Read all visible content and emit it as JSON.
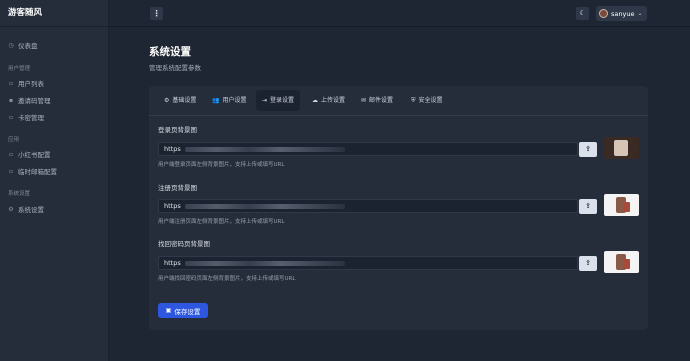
{
  "app": {
    "brand": "游客随风"
  },
  "sidebar": {
    "dashboard": {
      "label": "仪表盘",
      "icon": "dashboard-icon"
    },
    "sections": [
      {
        "title": "用户管理",
        "items": [
          {
            "label": "用户列表",
            "icon": "user-list-icon"
          },
          {
            "label": "邀请码管理",
            "icon": "invite-code-icon"
          },
          {
            "label": "卡密管理",
            "icon": "card-key-icon"
          }
        ]
      },
      {
        "title": "应用",
        "items": [
          {
            "label": "小红书配置",
            "icon": "note-icon"
          },
          {
            "label": "临时邮箱配置",
            "icon": "mail-icon"
          }
        ]
      },
      {
        "title": "系统设置",
        "items": [
          {
            "label": "系统设置",
            "icon": "gear-icon"
          }
        ]
      }
    ]
  },
  "topbar": {
    "username": "sanyue"
  },
  "page": {
    "title": "系统设置",
    "subtitle": "管理系统配置参数"
  },
  "tabs": [
    {
      "label": "基础设置",
      "icon": "gear-icon"
    },
    {
      "label": "用户设置",
      "icon": "users-icon"
    },
    {
      "label": "登录设置",
      "icon": "login-icon"
    },
    {
      "label": "上传设置",
      "icon": "cloud-upload-icon"
    },
    {
      "label": "邮件设置",
      "icon": "envelope-icon"
    },
    {
      "label": "安全设置",
      "icon": "shield-icon"
    }
  ],
  "active_tab": "登录设置",
  "fields": [
    {
      "label": "登录页背景图",
      "value": "https",
      "hint": "用户端登录页面左侧背景图片，支持上传或填写URL"
    },
    {
      "label": "注册页背景图",
      "value": "https",
      "hint": "用户端注册页面左侧背景图片，支持上传或填写URL"
    },
    {
      "label": "找回密码页背景图",
      "value": "https",
      "hint": "用户端找回密码页面左侧背景图片，支持上传或填写URL"
    }
  ],
  "save_button": {
    "label": "保存设置"
  }
}
